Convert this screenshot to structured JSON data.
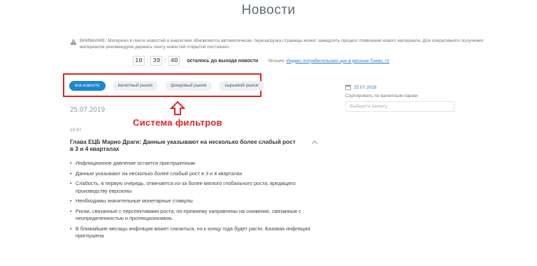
{
  "page": {
    "title": "Новости"
  },
  "notice": {
    "text": "ВНИМАНИЕ: Материал в ленте новостей и аналитики обновляется автоматически, перезагрузка страницы может замедлить процесс появления нового материала. Для оперативного получения материалов рекомендуем держать ленту новостей открытой постоянно."
  },
  "timer": {
    "hours": "10",
    "minutes": "39",
    "seconds": "40",
    "label": "осталось до выхода новости"
  },
  "upcoming": {
    "prefix": "Япония:",
    "link": "Индекс потребительских цен в регионе Токио, г/г"
  },
  "filters": [
    "все новости",
    "валютный рынок",
    "фондовый рынок",
    "сырьевой рынок"
  ],
  "annotation": {
    "label": "Система фильтров"
  },
  "feed": {
    "date": "25.07.2019",
    "time": "15:47",
    "headline": "Глава ЕЦБ Марио Драги: Данные указывают на несколько более слабый рост в 3 и 4 кварталах",
    "bullets": [
      "Инфляционное давление остается приглушенным",
      "Данные указывают на несколько более слабый рост в 3 и 4 кварталах",
      "Слабость, в первую очередь, отмечается из-за более мягкого глобального роста, вредящего производству еврозоны",
      "Необходимы значительные монетарные стимулы",
      "Риски, связанные с перспективами роста, по-прежнему направлены на снижение, связанные с неопределенностью и протекционизмом.",
      "В ближайшие месяцы инфляция может снизиться, но к концу года будет расти. Базовая инфляция приглушена"
    ]
  },
  "sidebar": {
    "date": "25.07.2019",
    "sort_label": "Сортировать по валютным парам",
    "select_placeholder": "Выберите валюту"
  },
  "colors": {
    "accent": "#1a88d0",
    "annotation": "#d9262a"
  }
}
